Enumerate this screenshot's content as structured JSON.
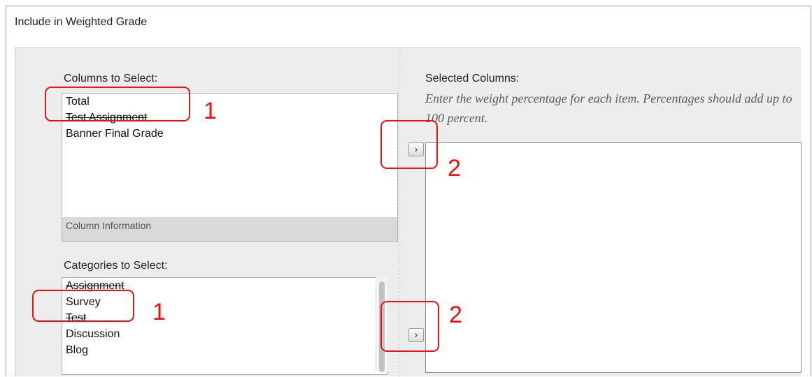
{
  "section": {
    "label": "Include in Weighted Grade"
  },
  "columns_to_select": {
    "label": "Columns to Select:",
    "items": [
      "Total",
      "Test Assignment",
      "Banner Final Grade"
    ],
    "info_label": "Column Information"
  },
  "categories_to_select": {
    "label": "Categories to Select:",
    "items": [
      "Assignment",
      "Survey",
      "Test",
      "Discussion",
      "Blog"
    ]
  },
  "selected_columns": {
    "label": "Selected Columns:",
    "help": "Enter the weight percentage for each item. Percentages should add up to 100 percent."
  },
  "buttons": {
    "add_column": "›",
    "add_category": "›"
  },
  "annotations": {
    "step1_columns": "1",
    "step2_columns": "2",
    "step1_categories": "1",
    "step2_categories": "2",
    "color": "#ee1111"
  }
}
